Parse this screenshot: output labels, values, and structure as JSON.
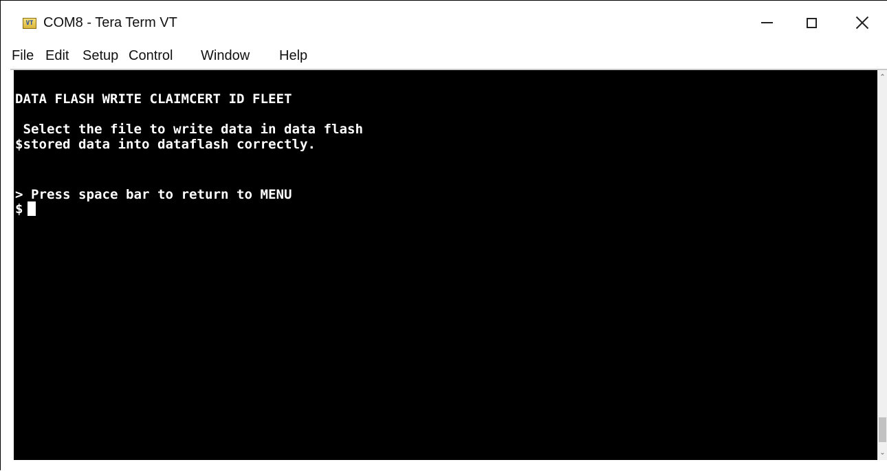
{
  "window": {
    "title": "COM8 - Tera Term VT",
    "icon_label": "VT",
    "icon": "tera-term-icon",
    "controls": {
      "minimize_icon": "minimize-icon",
      "maximize_icon": "maximize-icon",
      "close_icon": "close-icon"
    }
  },
  "menu": {
    "items": [
      "File",
      "Edit",
      "Setup",
      "Control",
      "Window",
      "Help"
    ]
  },
  "terminal": {
    "background": "#000000",
    "foreground": "#ffffff",
    "lines": [
      "DATA FLASH WRITE CLAIMCERT ID FLEET",
      " Select the file to write data in data flash",
      "$stored data into dataflash correctly.",
      "> Press space bar to return to MENU",
      "$"
    ]
  }
}
